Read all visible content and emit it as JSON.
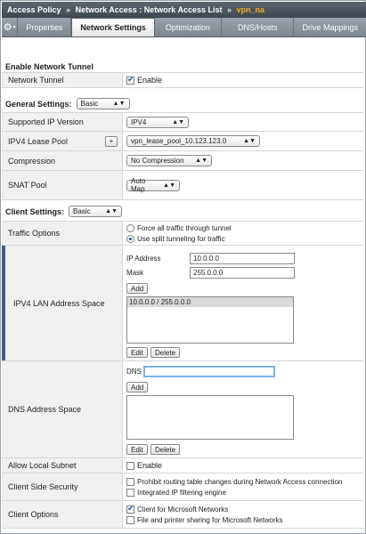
{
  "breadcrumb": {
    "part1": "Access Policy",
    "sep1": "»",
    "part2": "Network Access : Network Access List",
    "sep2": "»",
    "current": "vpn_na"
  },
  "tabs": [
    {
      "label": "Properties"
    },
    {
      "label": "Network Settings",
      "active": true
    },
    {
      "label": "Optimization"
    },
    {
      "label": "DNS/Hosts"
    },
    {
      "label": "Drive Mappings"
    }
  ],
  "icons": {
    "gear": "gear-icon",
    "dropdown": "chevron-down-icon",
    "checkmark": "check-icon"
  },
  "enable_network_tunnel": {
    "title": "Enable Network Tunnel",
    "label": "Network Tunnel",
    "checkbox_label": "Enable",
    "checked": true
  },
  "general": {
    "title": "General Settings:",
    "mode": "Basic",
    "supported_ip": {
      "label": "Supported IP Version",
      "value": "IPV4"
    },
    "lease_pool": {
      "label": "IPV4 Lease Pool",
      "add": "+",
      "value": "vpn_lease_pool_10.123.123.0"
    },
    "compression": {
      "label": "Compression",
      "value": "No Compression"
    },
    "snat": {
      "label": "SNAT Pool",
      "value": "Auto Map"
    }
  },
  "client": {
    "title": "Client Settings:",
    "mode": "Basic",
    "traffic": {
      "label": "Traffic Options",
      "opt1": "Force all traffic through tunnel",
      "opt2": "Use split tunneling for traffic",
      "selected": 2
    },
    "lan": {
      "label": "IPV4 LAN Address Space",
      "ip_label": "IP Address",
      "ip_value": "10.0.0.0",
      "mask_label": "Mask",
      "mask_value": "255.0.0.0",
      "add": "Add",
      "entry": "10.0.0.0 / 255.0.0.0",
      "edit": "Edit",
      "delete": "Delete"
    },
    "dns": {
      "label": "DNS Address Space",
      "dns_label": "DNS",
      "dns_value": "",
      "add": "Add",
      "edit": "Edit",
      "delete": "Delete"
    },
    "local_subnet": {
      "label": "Allow Local Subnet",
      "checkbox_label": "Enable",
      "checked": false
    },
    "security": {
      "label": "Client Side Security",
      "opt1": "Prohibit routing table changes during Network Access connection",
      "opt2": "Integrated IP filtering engine"
    },
    "options": {
      "label": "Client Options",
      "opt1": "Client for Microsoft Networks",
      "opt1_checked": true,
      "opt2": "File and printer sharing for Microsoft Networks"
    }
  },
  "colors": {
    "accent": "#3f5e86",
    "breadcrumb_current": "#f5a623"
  }
}
